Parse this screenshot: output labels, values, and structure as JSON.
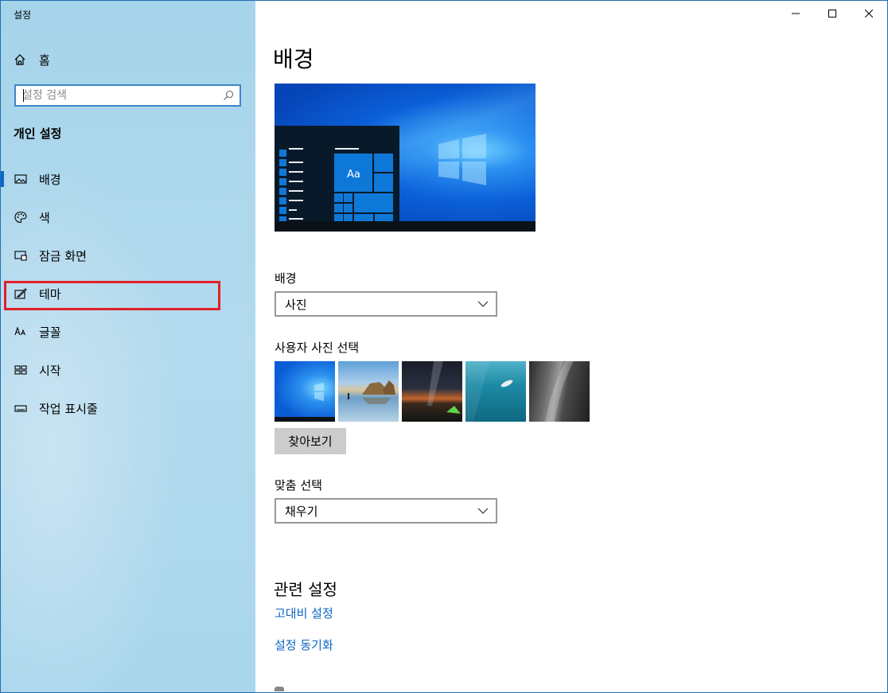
{
  "window": {
    "title": "설정"
  },
  "sidebar": {
    "home_label": "홈",
    "search_placeholder": "설정 검색",
    "section_title": "개인 설정",
    "items": [
      {
        "label": "배경",
        "icon": "picture-icon",
        "active": true
      },
      {
        "label": "색",
        "icon": "palette-icon",
        "active": false
      },
      {
        "label": "잠금 화면",
        "icon": "lock-screen-icon",
        "active": false
      },
      {
        "label": "테마",
        "icon": "theme-brush-icon",
        "active": false,
        "highlighted": true
      },
      {
        "label": "글꼴",
        "icon": "font-icon",
        "active": false
      },
      {
        "label": "시작",
        "icon": "start-icon",
        "active": false
      },
      {
        "label": "작업 표시줄",
        "icon": "taskbar-icon",
        "active": false
      }
    ]
  },
  "main": {
    "title": "배경",
    "preview_text": "Aa",
    "background_label": "배경",
    "background_value": "사진",
    "choose_picture_label": "사용자 사진 선택",
    "browse_label": "찾아보기",
    "fit_label": "맞춤 선택",
    "fit_value": "채우기",
    "related_title": "관련 설정",
    "links": [
      "고대비 설정",
      "설정 동기화"
    ]
  },
  "colors": {
    "accent": "#0b68c4",
    "link": "#0b65c2",
    "highlight_box": "#e0202a"
  }
}
